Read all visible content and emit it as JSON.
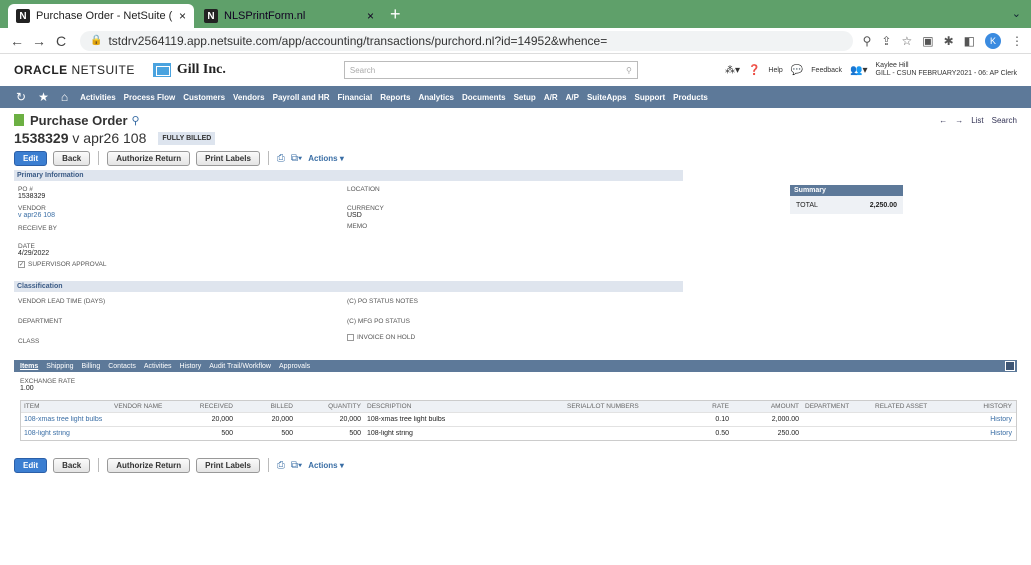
{
  "browser": {
    "tabs": [
      {
        "label": "Purchase Order - NetSuite (GI",
        "favicon": "N",
        "active": true
      },
      {
        "label": "NLSPrintForm.nl",
        "favicon": "N",
        "active": false
      }
    ],
    "new_tab": "+",
    "url": "tstdrv2564119.app.netsuite.com/app/accounting/transactions/purchord.nl?id=14952&whence=",
    "profile_initial": "K"
  },
  "header": {
    "logo_bold": "ORACLE",
    "logo_light": "NETSUITE",
    "company": "Gill Inc.",
    "search_placeholder": "Search",
    "help": "Help",
    "feedback": "Feedback",
    "user_name": "Kaylee Hill",
    "user_role": "GILL - CSUN FEBRUARY2021 - 06: AP Clerk"
  },
  "menu": [
    "Activities",
    "Process Flow",
    "Customers",
    "Vendors",
    "Payroll and HR",
    "Financial",
    "Reports",
    "Analytics",
    "Documents",
    "Setup",
    "A/R",
    "A/P",
    "SuiteApps",
    "Support",
    "Products"
  ],
  "page": {
    "title": "Purchase Order",
    "record_number": "1538329",
    "record_vendor": "v apr26 108",
    "status": "FULLY BILLED",
    "nav_list": "List",
    "nav_search": "Search"
  },
  "buttons": {
    "edit": "Edit",
    "back": "Back",
    "authorize_return": "Authorize Return",
    "print_labels": "Print Labels",
    "actions": "Actions ▾"
  },
  "primary": {
    "header": "Primary Information",
    "po_label": "PO #",
    "po_value": "1538329",
    "vendor_label": "VENDOR",
    "vendor_value": "v apr26 108",
    "receive_by_label": "RECEIVE BY",
    "date_label": "DATE",
    "date_value": "4/29/2022",
    "supervisor_label": "SUPERVISOR APPROVAL",
    "location_label": "LOCATION",
    "currency_label": "CURRENCY",
    "currency_value": "USD",
    "memo_label": "MEMO"
  },
  "summary": {
    "header": "Summary",
    "total_label": "TOTAL",
    "total_value": "2,250.00"
  },
  "classification": {
    "header": "Classification",
    "lead_time_label": "VENDOR LEAD TIME (DAYS)",
    "department_label": "DEPARTMENT",
    "class_label": "CLASS",
    "po_status_notes_label": "(C) PO STATUS NOTES",
    "mfg_po_status_label": "(C) MFG PO STATUS",
    "invoice_on_hold_label": "INVOICE ON HOLD"
  },
  "subtabs": [
    "Items",
    "Shipping",
    "Billing",
    "Contacts",
    "Activities",
    "History",
    "Audit Trail/Workflow",
    "Approvals"
  ],
  "items": {
    "exchange_rate_label": "EXCHANGE RATE",
    "exchange_rate_value": "1.00",
    "columns": [
      "ITEM",
      "VENDOR NAME",
      "RECEIVED",
      "BILLED",
      "QUANTITY",
      "DESCRIPTION",
      "SERIAL/LOT NUMBERS",
      "RATE",
      "AMOUNT",
      "DEPARTMENT",
      "RELATED ASSET",
      "HISTORY"
    ],
    "rows": [
      {
        "item": "108-xmas tree light bulbs",
        "vendor_name": "",
        "received": "20,000",
        "billed": "20,000",
        "quantity": "20,000",
        "description": "108-xmas tree light bulbs",
        "serial": "",
        "rate": "0.10",
        "amount": "2,000.00",
        "department": "",
        "asset": "",
        "history": "History"
      },
      {
        "item": "108-light string",
        "vendor_name": "",
        "received": "500",
        "billed": "500",
        "quantity": "500",
        "description": "108-light string",
        "serial": "",
        "rate": "0.50",
        "amount": "250.00",
        "department": "",
        "asset": "",
        "history": "History"
      }
    ]
  }
}
